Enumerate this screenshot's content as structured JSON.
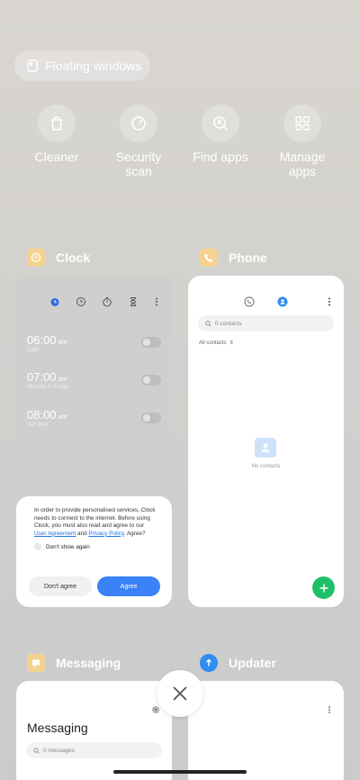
{
  "floating": {
    "label": "Floating windows"
  },
  "tools": [
    {
      "label": "Cleaner",
      "icon": "trash-icon"
    },
    {
      "label": "Security\nscan",
      "icon": "security-scan-icon"
    },
    {
      "label": "Find apps",
      "icon": "find-apps-icon"
    },
    {
      "label": "Manage\napps",
      "icon": "grid-icon"
    }
  ],
  "apps": {
    "clock": {
      "name": "Clock",
      "alarms": [
        {
          "time": "06:00",
          "ampm": "am",
          "repeat": "Daily"
        },
        {
          "time": "07:00",
          "ampm": "am",
          "repeat": "Monday to Friday"
        },
        {
          "time": "08:00",
          "ampm": "am",
          "repeat": "Get Sbirt"
        }
      ],
      "dialog": {
        "text_pre": "In order to provide personalised services, Clock needs to connect to the internet. Before using Clock, you must also read and agree to our ",
        "link1": "User Agreement",
        "mid": " and ",
        "link2": "Privacy Policy",
        "text_post": ". Agree?",
        "checkbox": "Don't show again",
        "cancel": "Don't agree",
        "confirm": "Agree"
      }
    },
    "phone": {
      "name": "Phone",
      "search_placeholder": "0 contacts",
      "filter": "All contacts",
      "empty": "No contacts"
    },
    "messaging": {
      "name": "Messaging",
      "title": "Messaging",
      "search_placeholder": "0 messages"
    },
    "updater": {
      "name": "Updater"
    }
  },
  "colors": {
    "accent": "#3a82f7",
    "fab": "#1fbf6a",
    "clock_icon": "#f6d28f",
    "phone_icon": "#f6d28f",
    "msg_icon": "#f6d28f",
    "updater_icon": "#2f8ef0"
  }
}
